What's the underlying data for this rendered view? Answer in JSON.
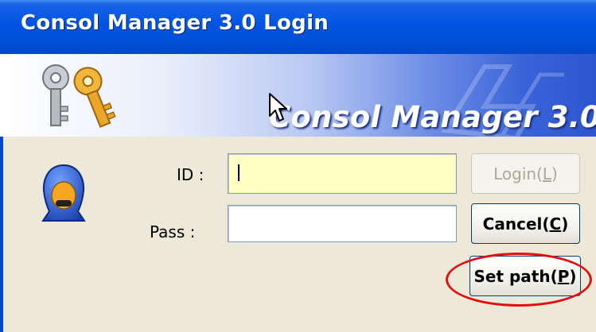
{
  "window": {
    "title": "Consol Manager 3.0 Login"
  },
  "banner": {
    "title": "Consol Manager 3.0",
    "icon": "keys-icon"
  },
  "form": {
    "id_label": "ID :",
    "id_value": "",
    "pass_label": "Pass :",
    "pass_value": ""
  },
  "buttons": {
    "login_label": "Login(",
    "login_mnemonic": "L",
    "login_tail": ")",
    "cancel_label": "Cancel(",
    "cancel_mnemonic": "C",
    "cancel_tail": ")",
    "setpath_label": "Set path(",
    "setpath_mnemonic": "P",
    "setpath_tail": ")"
  },
  "colors": {
    "titlebar": "#0054e3",
    "id_field_bg": "#ffffc5",
    "highlight": "#e01010"
  },
  "icons": [
    "keys-icon",
    "user-avatar-icon",
    "mouse-cursor-icon"
  ]
}
